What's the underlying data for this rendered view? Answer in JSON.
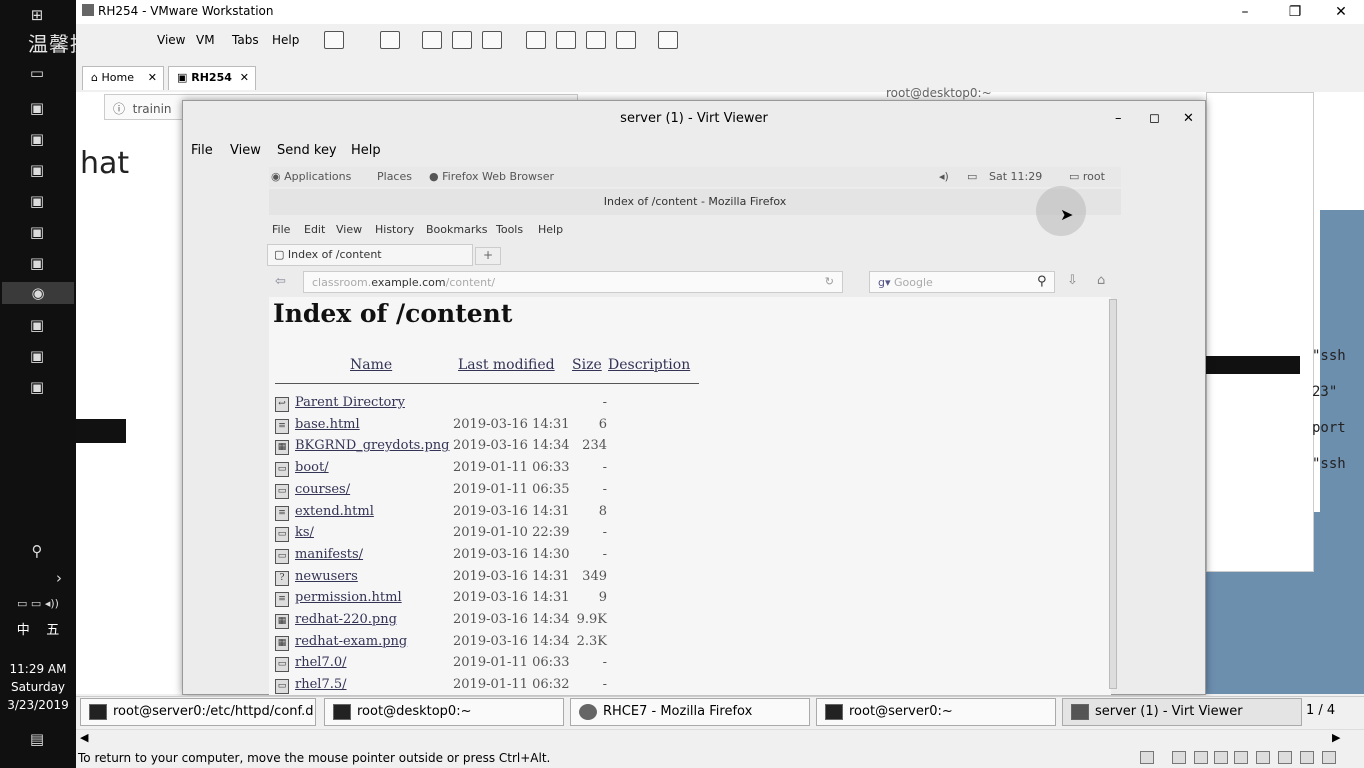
{
  "taskbar": {
    "time": "11:29 AM",
    "day": "Saturday",
    "date": "3/23/2019",
    "ime_lang": "中",
    "ime_mode": "五"
  },
  "watermark": "温馨提示",
  "vmware": {
    "title": "RH254 - VMware Workstation",
    "menus": [
      "View",
      "VM",
      "Tabs",
      "Help"
    ],
    "tabs": [
      {
        "label": "Home"
      },
      {
        "label": "RH254"
      }
    ],
    "guest_bg_text": {
      "address": "trainin",
      "hat": "hat",
      "terminal_title": "root@desktop0:~",
      "term_lines": [
        "\"ssh",
        "23\"",
        "port",
        "\"ssh"
      ]
    },
    "task_items": [
      {
        "label": "root@server0:/etc/httpd/conf.d"
      },
      {
        "label": "root@desktop0:~"
      },
      {
        "label": "RHCE7 - Mozilla Firefox"
      },
      {
        "label": "root@server0:~"
      },
      {
        "label": "server (1) - Virt Viewer"
      }
    ],
    "pager": "1 / 4",
    "status_text": "To return to your computer, move the mouse pointer outside or press Ctrl+Alt."
  },
  "virt_viewer": {
    "title": "server (1) - Virt Viewer",
    "menus": [
      "File",
      "View",
      "Send key",
      "Help"
    ]
  },
  "gnome": {
    "applications": "Applications",
    "places": "Places",
    "app_name": "Firefox Web Browser",
    "clock": "Sat 11:29",
    "user": "root"
  },
  "firefox": {
    "window_title": "Index of /content - Mozilla Firefox",
    "menus": [
      "File",
      "Edit",
      "View",
      "History",
      "Bookmarks",
      "Tools",
      "Help"
    ],
    "tab_label": "Index of /content",
    "url_prefix": "classroom.",
    "url_host": "example.com",
    "url_path": "/content/",
    "search_placeholder": "Google"
  },
  "listing": {
    "heading": "Index of /content",
    "columns": {
      "name": "Name",
      "modified": "Last modified",
      "size": "Size",
      "description": "Description"
    },
    "rows": [
      {
        "name": "Parent Directory",
        "date": "",
        "size": "-",
        "icon": "back-icon"
      },
      {
        "name": "base.html",
        "date": "2019-03-16 14:31",
        "size": "6",
        "icon": "file-icon"
      },
      {
        "name": "BKGRND_greydots.png",
        "date": "2019-03-16 14:34",
        "size": "234",
        "icon": "image-icon"
      },
      {
        "name": "boot/",
        "date": "2019-01-11 06:33",
        "size": "-",
        "icon": "folder-icon"
      },
      {
        "name": "courses/",
        "date": "2019-01-11 06:35",
        "size": "-",
        "icon": "folder-icon"
      },
      {
        "name": "extend.html",
        "date": "2019-03-16 14:31",
        "size": "8",
        "icon": "file-icon"
      },
      {
        "name": "ks/",
        "date": "2019-01-10 22:39",
        "size": "-",
        "icon": "folder-icon"
      },
      {
        "name": "manifests/",
        "date": "2019-03-16 14:30",
        "size": "-",
        "icon": "folder-icon"
      },
      {
        "name": "newusers",
        "date": "2019-03-16 14:31",
        "size": "349",
        "icon": "unknown-icon"
      },
      {
        "name": "permission.html",
        "date": "2019-03-16 14:31",
        "size": "9",
        "icon": "file-icon"
      },
      {
        "name": "redhat-220.png",
        "date": "2019-03-16 14:34",
        "size": "9.9K",
        "icon": "image-icon"
      },
      {
        "name": "redhat-exam.png",
        "date": "2019-03-16 14:34",
        "size": "2.3K",
        "icon": "image-icon"
      },
      {
        "name": "rhel7.0/",
        "date": "2019-01-11 06:33",
        "size": "-",
        "icon": "folder-icon"
      },
      {
        "name": "rhel7.5/",
        "date": "2019-01-11 06:32",
        "size": "-",
        "icon": "folder-icon"
      }
    ]
  }
}
